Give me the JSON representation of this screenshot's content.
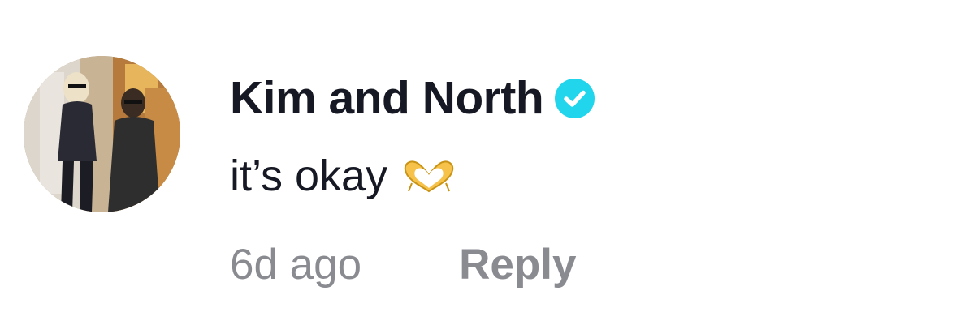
{
  "comment": {
    "username": "Kim and North",
    "verified_icon": "verified-badge-icon",
    "text": "it’s okay",
    "emoji_icon": "heart-hands-icon",
    "timestamp": "6d ago",
    "reply_label": "Reply",
    "colors": {
      "verified": "#20d5ec",
      "username": "#161823",
      "meta": "#8a8b91"
    }
  }
}
